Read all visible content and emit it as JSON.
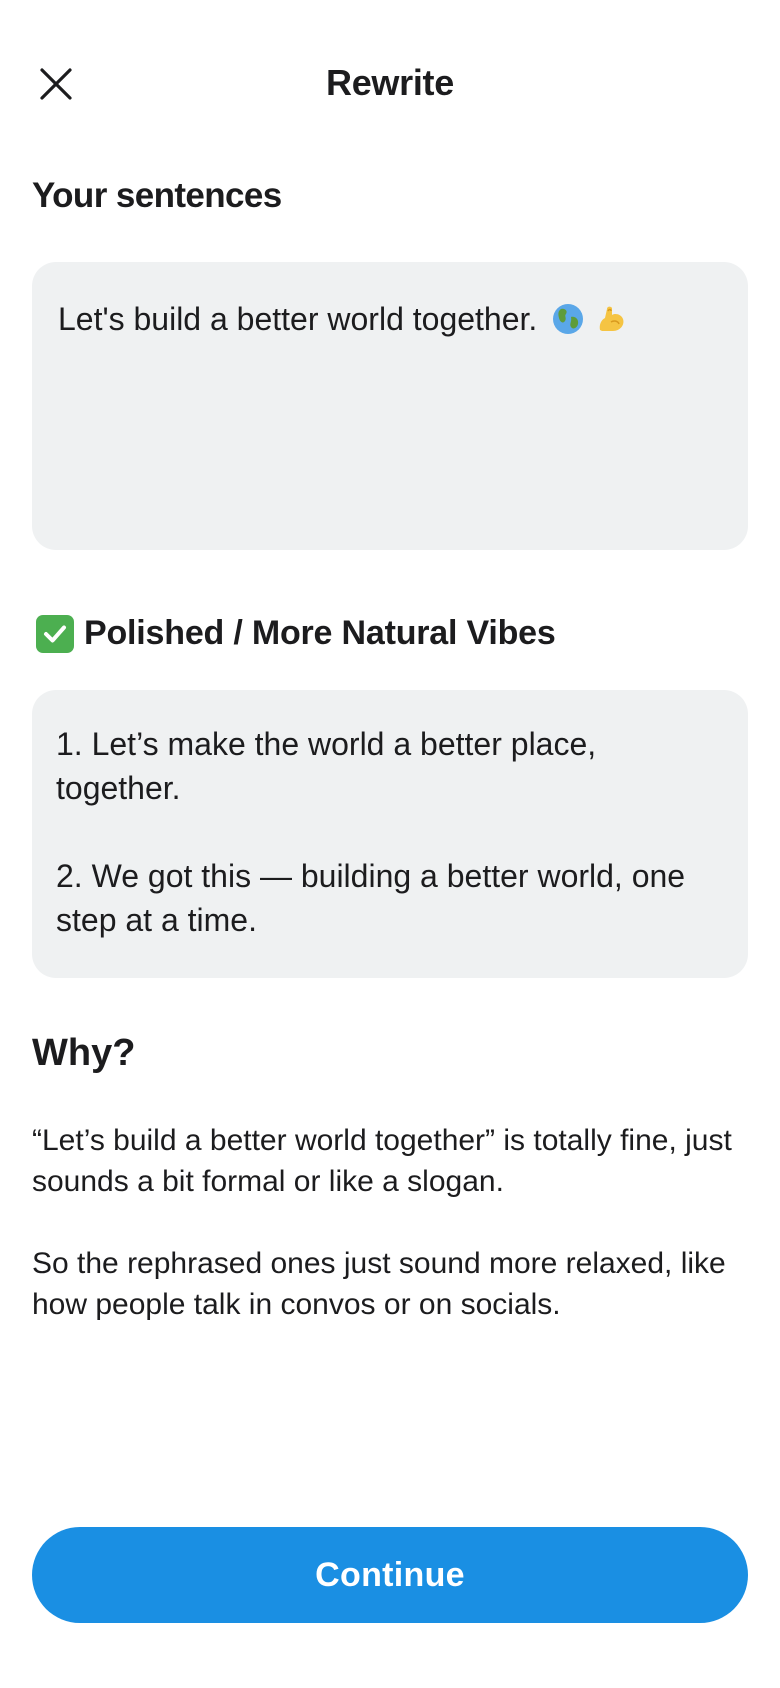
{
  "header": {
    "title": "Rewrite",
    "close_icon": "close-icon"
  },
  "input": {
    "label": "Your sentences",
    "text": "Let's build a better world together.",
    "emojis": [
      "globe-icon",
      "flexed-biceps-icon"
    ]
  },
  "result": {
    "heading": "Polished / More Natural Vibes",
    "check_icon": "check-mark-icon",
    "items": [
      "1. Let’s make the world a better place, together.",
      "2. We got this — building a better world, one step at a time."
    ]
  },
  "why": {
    "heading": "Why?",
    "paragraphs": [
      "“Let’s build a better world together” is totally fine, just sounds a bit formal or like a slogan.",
      "So the rephrased ones just sound more relaxed, like how people talk in convos or on socials."
    ]
  },
  "footer": {
    "continue_label": "Continue"
  },
  "colors": {
    "accent": "#1a8fe3",
    "box_background": "#eff1f2",
    "check_green": "#4caf50",
    "text": "#1c1c1e"
  }
}
